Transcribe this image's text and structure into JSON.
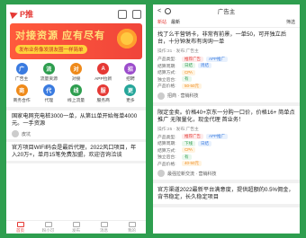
{
  "left": {
    "brand": "P推",
    "banner": {
      "headline": "对接资源 应有尽有",
      "pill": "发布业务像发朋友圈一样简单"
    },
    "grid": [
      {
        "label": "广告主",
        "color": "#3a7be0",
        "glyph": "广"
      },
      {
        "label": "流量资源",
        "color": "#2e9e4f",
        "glyph": "流"
      },
      {
        "label": "对接",
        "color": "#ef8a1a",
        "glyph": "对"
      },
      {
        "label": "APP拉新",
        "color": "#e53935",
        "glyph": "A"
      },
      {
        "label": "招聘",
        "color": "#9c4dcc",
        "glyph": "招"
      },
      {
        "label": "商务合作",
        "color": "#ef8a1a",
        "glyph": "商"
      },
      {
        "label": "代理",
        "color": "#3a7be0",
        "glyph": "代"
      },
      {
        "label": "线上流量",
        "color": "#2e9e4f",
        "glyph": "线"
      },
      {
        "label": "服务商",
        "color": "#e53935",
        "glyph": "服"
      },
      {
        "label": "更多",
        "color": "#26a69a",
        "glyph": "更"
      }
    ],
    "posts": [
      {
        "title": "国家电网充电桩3000一单，从第11单开始每单4000元。一手资源",
        "meta": "",
        "user": "皮坑"
      },
      {
        "title": "官方项目WIFI码会是最后代理，2022风口项目，年入20万+，单月15笔免费加盟，欢迎咨询洽谈",
        "meta": "",
        "user": ""
      }
    ],
    "tabs": [
      "首页",
      "粉小可",
      "发布",
      "消息",
      "我的"
    ]
  },
  "right": {
    "title": "广告主",
    "filters": {
      "active": "新站",
      "second": "最新",
      "filter": "筛选"
    },
    "cards": [
      {
        "title": "找了么干营销卡，非常有前景，一单50，可开独立后台，十分钟发布有询询一单",
        "meta": "操作:31 · 发布:广告主",
        "rows": [
          {
            "k": "产品类型:",
            "tags": [
              {
                "t": "推荐广告",
                "c": "tg"
              },
              {
                "t": "APP推广",
                "c": "tb"
              }
            ]
          },
          {
            "k": "结算周期:",
            "tags": [
              {
                "t": "日结",
                "c": "tgr"
              },
              {
                "t": "周结",
                "c": "tb"
              }
            ]
          },
          {
            "k": "结算方式:",
            "tags": [
              {
                "t": "CPA",
                "c": "to"
              }
            ]
          },
          {
            "k": "独立后台:",
            "tags": [
              {
                "t": "有",
                "c": "tgr"
              }
            ]
          },
          {
            "k": "产品价格:",
            "tags": [
              {
                "t": "50-50元",
                "c": "to"
              }
            ]
          }
        ],
        "user": "招商 · 营销科技"
      },
      {
        "title": "限定金卖。价格40+京东一分购一口价，价格16+ 简单点推广 无限量化，现金代理 首业务！",
        "meta": "操作:25 · 发布:广告主",
        "rows": [
          {
            "k": "产品类型:",
            "tags": [
              {
                "t": "推荐广告",
                "c": "tg"
              },
              {
                "t": "APP推广",
                "c": "tb"
              }
            ]
          },
          {
            "k": "结算周期:",
            "tags": [
              {
                "t": "下线",
                "c": "tgr"
              },
              {
                "t": "日结",
                "c": "tb"
              }
            ]
          },
          {
            "k": "结算方式:",
            "tags": [
              {
                "t": "CPA",
                "c": "to"
              }
            ]
          },
          {
            "k": "独立后台:",
            "tags": [
              {
                "t": "有",
                "c": "tgr"
              }
            ]
          },
          {
            "k": "产品价格:",
            "tags": [
              {
                "t": "40-50元",
                "c": "to"
              }
            ]
          }
        ],
        "user": "最强拉新交流 · 营销科技"
      },
      {
        "title": "官方渠道2022最新平台满意度，提供超额的0.5%佣金，背书稳定，长久稳定项目",
        "meta": "",
        "rows": [],
        "user": ""
      }
    ]
  }
}
